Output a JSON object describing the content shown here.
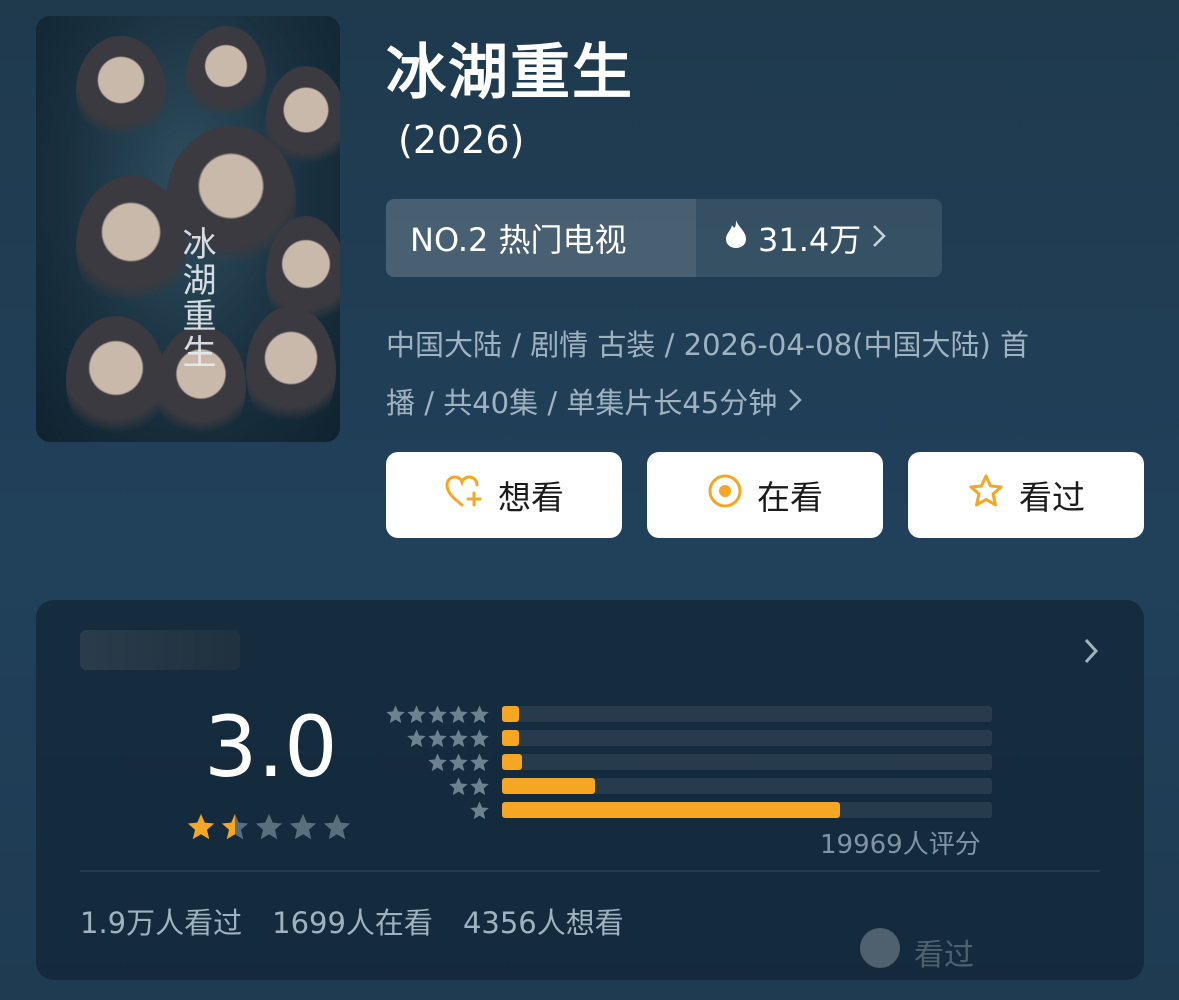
{
  "header": {
    "title": "冰湖重生",
    "year": "(2026)",
    "poster_title": "冰湖重生"
  },
  "rank": {
    "label": "NO.2 热门电视",
    "heat": "31.4万"
  },
  "meta": {
    "line1": "中国大陆 / 剧情 古装 / 2026-04-08(中国大陆) 首",
    "line2": "播 / 共40集 / 单集片长45分钟"
  },
  "actions": {
    "want": "想看",
    "watching": "在看",
    "watched": "看过"
  },
  "rating": {
    "score": "3.0",
    "stars_value": 1.5,
    "distribution": [
      {
        "stars": 5,
        "fraction": 0.035
      },
      {
        "stars": 4,
        "fraction": 0.035
      },
      {
        "stars": 3,
        "fraction": 0.04
      },
      {
        "stars": 2,
        "fraction": 0.19
      },
      {
        "stars": 1,
        "fraction": 0.69
      }
    ],
    "count_label": "19969人评分"
  },
  "stats": {
    "watched": "1.9万人看过",
    "watching": "1699人在看",
    "want": "4356人想看"
  },
  "faded_action": "看过",
  "colors": {
    "accent": "#f5a623",
    "muted": "#9fb2bf"
  }
}
